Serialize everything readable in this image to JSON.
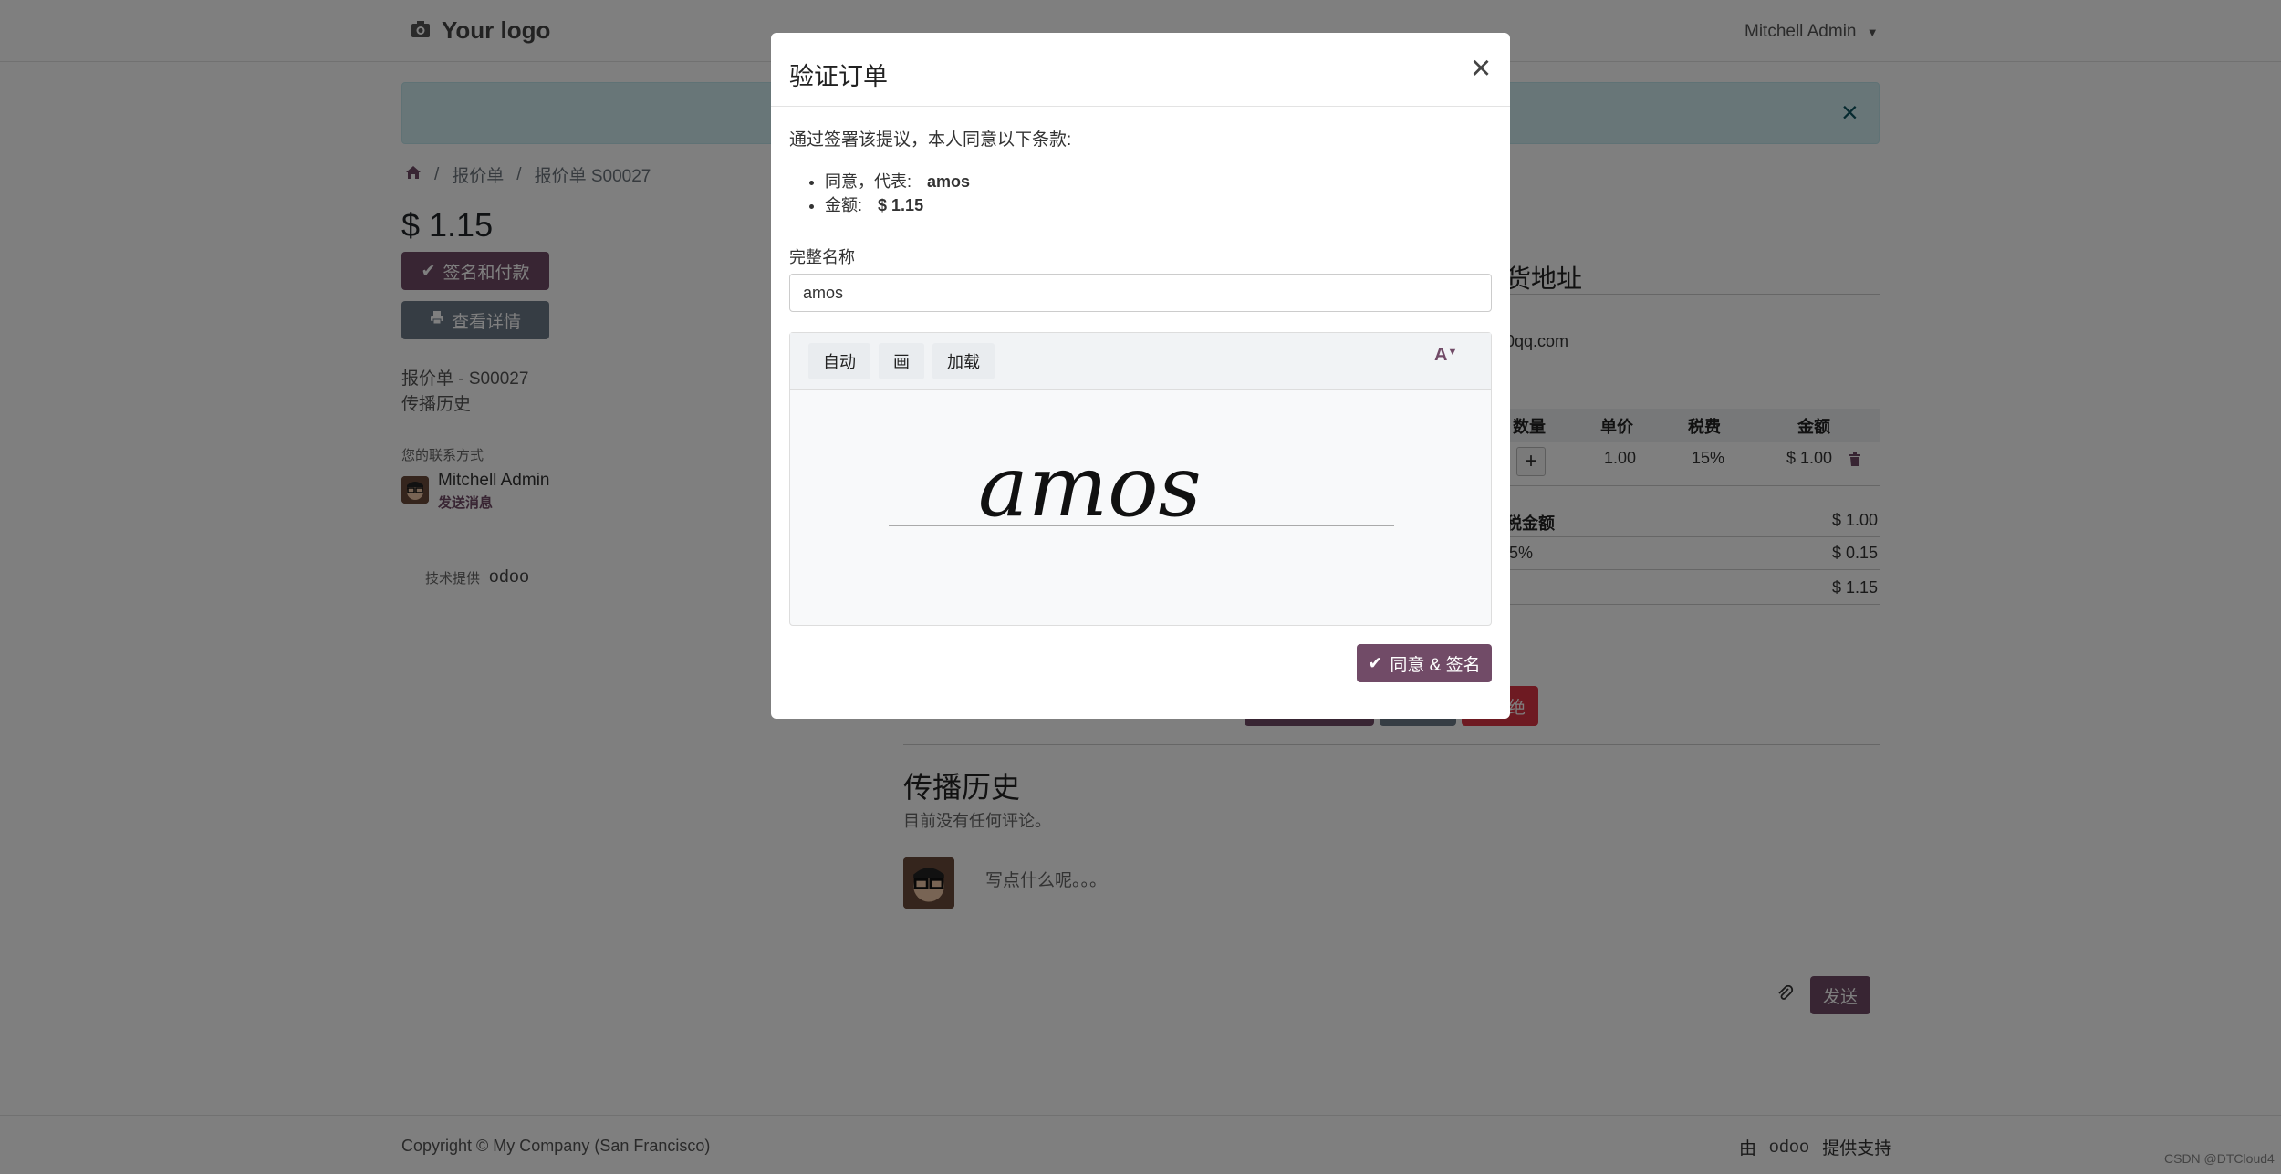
{
  "header": {
    "logo_text": "Your logo",
    "user_name": "Mitchell Admin"
  },
  "breadcrumb": [
    "报价单",
    "报价单 S00027"
  ],
  "page": {
    "price": "$ 1.15",
    "sign_pay_label": "签名和付款",
    "view_details_label": "查看详情",
    "sidebar_links": [
      "报价单 - S00027",
      "传播历史"
    ],
    "contact_label": "您的联系方式",
    "contact_name": "Mitchell Admin",
    "contact_message": "发送消息",
    "powered_by": "技术提供",
    "odoo_brand": "odoo"
  },
  "order": {
    "shipping_title": "货地址",
    "email_fragment": "0qq.com",
    "headers": [
      "数量",
      "单价",
      "税费",
      "金额"
    ],
    "row": {
      "unit_price": "1.00",
      "tax": "15%",
      "amount": "$ 1.00"
    },
    "summary": [
      {
        "label": "税金额",
        "value": "$ 1.00"
      },
      {
        "label": "5%",
        "value": "$ 0.15"
      },
      {
        "label": "",
        "value": "$ 1.15"
      }
    ],
    "reject_fragment": "绝"
  },
  "history": {
    "title": "传播历史",
    "empty_text": "目前没有任何评论。",
    "comment_placeholder": "写点什么呢。。。",
    "send_label": "发送"
  },
  "footer": {
    "copyright": "Copyright © My Company (San Francisco)",
    "by": "由",
    "odoo_brand": "odoo",
    "support": "提供支持",
    "watermark": "CSDN @DTCloud4"
  },
  "modal": {
    "title": "验证订单",
    "terms": "通过签署该提议，本人同意以下条款:",
    "agree_on_behalf_label": "同意，代表:",
    "agree_on_behalf_value": "amos",
    "amount_label": "金额:",
    "amount_value": "$ 1.15",
    "full_name_label": "完整名称",
    "full_name_value": "amos",
    "tabs": [
      "自动",
      "画",
      "加载"
    ],
    "signature_text": "amos",
    "agree_button": "同意 & 签名"
  },
  "colors": {
    "primary": "#714b67",
    "secondary": "#6c7a89",
    "danger": "#dc3545",
    "info_bg": "#d1ecf1"
  }
}
